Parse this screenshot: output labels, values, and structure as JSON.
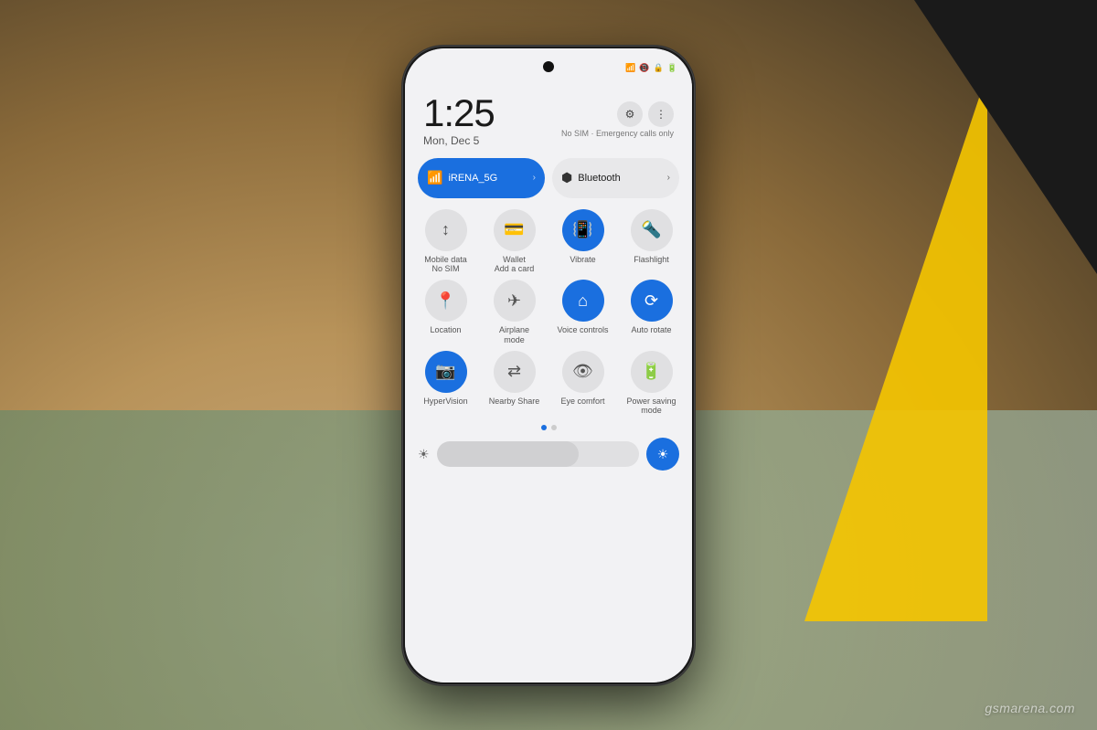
{
  "background": {
    "primary_color": "#5a4a3a",
    "floor_color": "#7a9a80",
    "yellow_accent": "#f5c500"
  },
  "status_bar": {
    "icons": [
      "wifi",
      "signal",
      "lock",
      "battery"
    ]
  },
  "time": {
    "time_value": "1:25",
    "date_value": "Mon, Dec 5"
  },
  "sim_status": "No SIM · Emergency calls only",
  "header": {
    "settings_icon": "⚙",
    "more_icon": "⋮"
  },
  "toggles": {
    "wifi": {
      "label": "iRENA_5G",
      "active": true,
      "icon": "wifi"
    },
    "bluetooth": {
      "label": "Bluetooth",
      "active": false,
      "icon": "bluetooth"
    }
  },
  "quick_settings": [
    {
      "id": "mobile-data",
      "label": "Mobile data\nNo SIM",
      "icon": "↕",
      "active": false
    },
    {
      "id": "wallet",
      "label": "Wallet\nAdd a card",
      "icon": "💳",
      "active": false
    },
    {
      "id": "vibrate",
      "label": "Vibrate",
      "icon": "📳",
      "active": true
    },
    {
      "id": "flashlight",
      "label": "Flashlight",
      "icon": "🔦",
      "active": false
    },
    {
      "id": "location",
      "label": "Location",
      "icon": "📍",
      "active": false
    },
    {
      "id": "airplane",
      "label": "Airplane\nmode",
      "icon": "✈",
      "active": false
    },
    {
      "id": "voice-controls",
      "label": "Voice controls",
      "icon": "🏠",
      "active": true
    },
    {
      "id": "auto-rotate",
      "label": "Auto rotate",
      "icon": "🔄",
      "active": true
    },
    {
      "id": "hypervision",
      "label": "HyperVision",
      "icon": "📷",
      "active": true
    },
    {
      "id": "nearby-share",
      "label": "Nearby Share",
      "icon": "⇄",
      "active": false
    },
    {
      "id": "eye-comfort",
      "label": "Eye comfort",
      "icon": "👁",
      "active": false
    },
    {
      "id": "power-saving",
      "label": "Power saving\nmode",
      "icon": "🔋",
      "active": false
    }
  ],
  "dots": {
    "total": 2,
    "active_index": 0
  },
  "brightness": {
    "level": 70,
    "min_icon": "☀",
    "max_icon": "☀"
  },
  "watermark": "gsmarena.com"
}
